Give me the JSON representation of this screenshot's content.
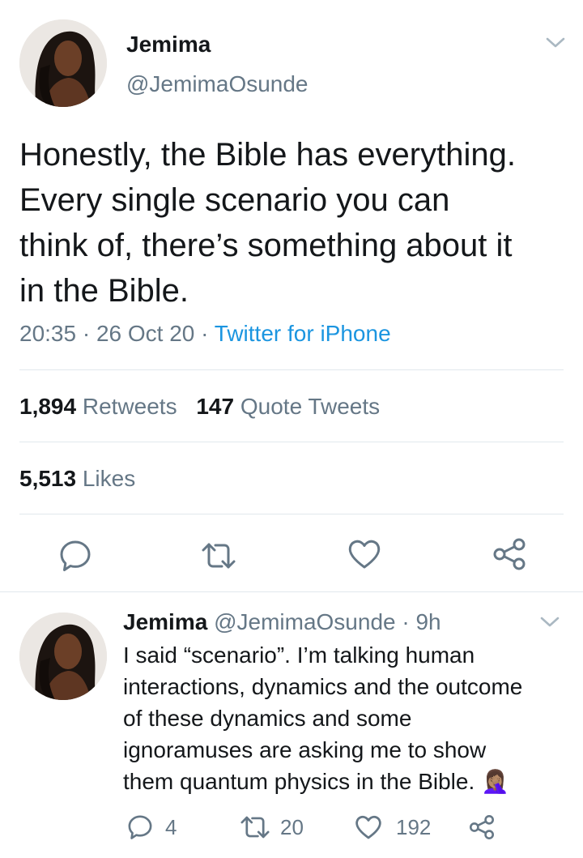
{
  "main_tweet": {
    "author_name": "Jemima",
    "author_handle": "@JemimaOsunde",
    "text": "Honestly, the Bible has everything. Every single scenario you can think of, there’s something about it in the Bible.",
    "lines": [
      "Honestly, the Bible has everything.",
      "Every single scenario you can",
      "think of, there’s something about it",
      "in the Bible."
    ],
    "time": "20:35",
    "date": "26 Oct 20",
    "separator": "·",
    "source": "Twitter for iPhone",
    "retweets_count": "1,894",
    "retweets_label": "Retweets",
    "quote_count": "147",
    "quote_label": "Quote Tweets",
    "likes_count": "5,513",
    "likes_label": "Likes"
  },
  "reply": {
    "author_name": "Jemima",
    "author_handle": "@JemimaOsunde",
    "separator": "·",
    "age": "9h",
    "lines": [
      "I said “scenario”. I’m talking human",
      "interactions, dynamics and the outcome",
      "of these dynamics and some",
      "ignoramuses are asking me to show",
      "them quantum physics in the Bible. 🤦🏽‍♀️"
    ],
    "reply_count": "4",
    "retweet_count": "20",
    "like_count": "192"
  },
  "icons": {
    "reply": "reply-icon",
    "retweet": "retweet-icon",
    "like": "heart-icon",
    "share": "share-icon",
    "menu": "chevron-down-icon"
  },
  "colors": {
    "text": "#14171a",
    "secondary": "#657786",
    "link": "#1b95e0",
    "divider": "#e1e8ed"
  }
}
